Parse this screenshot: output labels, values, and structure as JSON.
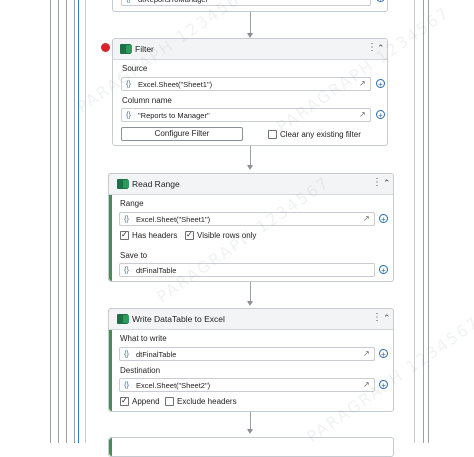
{
  "top_partial": {
    "value": "dtReportsToManager"
  },
  "filter": {
    "title": "Filter",
    "source_label": "Source",
    "source_value": "Excel.Sheet(\"Sheet1\")",
    "column_label": "Column name",
    "column_value": "\"Reports to Manager\"",
    "configure_label": "Configure Filter",
    "clear_label": "Clear any existing filter"
  },
  "read_range": {
    "title": "Read Range",
    "range_label": "Range",
    "range_value": "Excel.Sheet(\"Sheet1\")",
    "has_headers_label": "Has headers",
    "visible_rows_label": "Visible rows only",
    "save_to_label": "Save to",
    "save_to_value": "dtFinalTable"
  },
  "write_dt": {
    "title": "Write DataTable to Excel",
    "what_label": "What to write",
    "what_value": "dtFinalTable",
    "dest_label": "Destination",
    "dest_value": "Excel.Sheet(\"Sheet2\")",
    "append_label": "Append",
    "exclude_label": "Exclude headers"
  },
  "icons": {
    "brace": "{}",
    "plus": "+",
    "kebab": "⋮",
    "collapse": "⌃",
    "expand": "↗"
  },
  "watermark": "PARAGRAPH 1234567"
}
